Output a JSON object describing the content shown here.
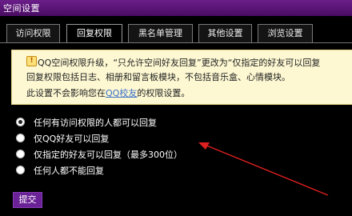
{
  "window": {
    "title": "空间设置"
  },
  "tabs": [
    {
      "label": "访问权限",
      "active": false
    },
    {
      "label": "回复权限",
      "active": true
    },
    {
      "label": "黑名单管理",
      "active": false
    },
    {
      "label": "其他设置",
      "active": false
    },
    {
      "label": "浏览设置",
      "active": false
    }
  ],
  "notice": {
    "line1": "QQ空间权限升级，“只允许空间好友回复”更改为“仅指定的好友可以回复",
    "line2": "回复权限包括日志、相册和留言板模块，不包括音乐盒、心情模块。",
    "line3_pre": "此设置不会影响您在",
    "line3_link": "QQ校友",
    "line3_post": "的权限设置。"
  },
  "options": [
    {
      "label": "任何有访问权限的人都可以回复",
      "checked": true
    },
    {
      "label": "仅QQ好友可以回复",
      "checked": false
    },
    {
      "label": "仅指定的好友可以回复（最多300位）",
      "checked": false
    },
    {
      "label": "任何人都不能回复",
      "checked": false
    }
  ],
  "submit_label": "提交",
  "colors": {
    "accent": "#6b2296",
    "arrow": "#e02020",
    "notice_bg": "#fdf8d2"
  }
}
